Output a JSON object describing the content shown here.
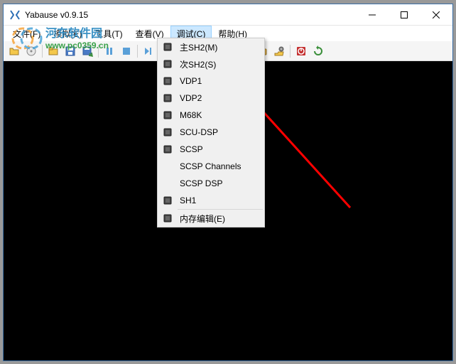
{
  "window": {
    "title": "Yabause v0.9.15"
  },
  "menus": {
    "file": "文件(F)",
    "emulation": "模拟(E)",
    "tools": "工具(T)",
    "view": "查看(V)",
    "debug": "调试(C)",
    "help": "帮助(H)"
  },
  "debug_menu": {
    "main_sh2": "主SH2(M)",
    "slave_sh2": "次SH2(S)",
    "vdp1": "VDP1",
    "vdp2": "VDP2",
    "m68k": "M68K",
    "scu_dsp": "SCU-DSP",
    "scsp": "SCSP",
    "scsp_channels": "SCSP Channels",
    "scsp_dsp": "SCSP DSP",
    "sh1": "SH1",
    "mem_edit": "内存编辑(E)"
  },
  "watermark": {
    "line1": "河东软件园",
    "line2": "www.pc0359.cn"
  }
}
